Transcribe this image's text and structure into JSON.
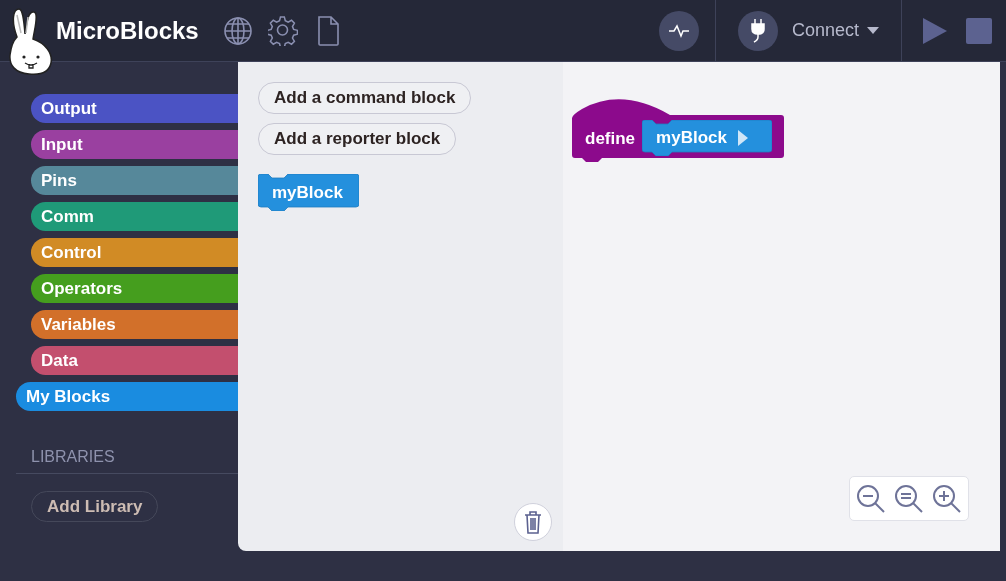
{
  "app": {
    "title": "MicroBlocks"
  },
  "connection": {
    "label": "Connect"
  },
  "categories": [
    {
      "label": "Output",
      "color": "#4b53c4",
      "selected": false
    },
    {
      "label": "Input",
      "color": "#9a40a0",
      "selected": false
    },
    {
      "label": "Pins",
      "color": "#56889a",
      "selected": false
    },
    {
      "label": "Comm",
      "color": "#1f9a78",
      "selected": false
    },
    {
      "label": "Control",
      "color": "#d18b25",
      "selected": false
    },
    {
      "label": "Operators",
      "color": "#459e1e",
      "selected": false
    },
    {
      "label": "Variables",
      "color": "#d2702a",
      "selected": false
    },
    {
      "label": "Data",
      "color": "#c34f6e",
      "selected": false
    },
    {
      "label": "My Blocks",
      "color": "#1a8ce0",
      "selected": true
    }
  ],
  "libraries": {
    "heading": "LIBRARIES",
    "button": "Add Library"
  },
  "palette": {
    "buttons": [
      "Add a command block",
      "Add a reporter block"
    ],
    "blocks": [
      {
        "label": "myBlock"
      }
    ]
  },
  "script": {
    "define_label": "define",
    "block_label": "myBlock"
  }
}
